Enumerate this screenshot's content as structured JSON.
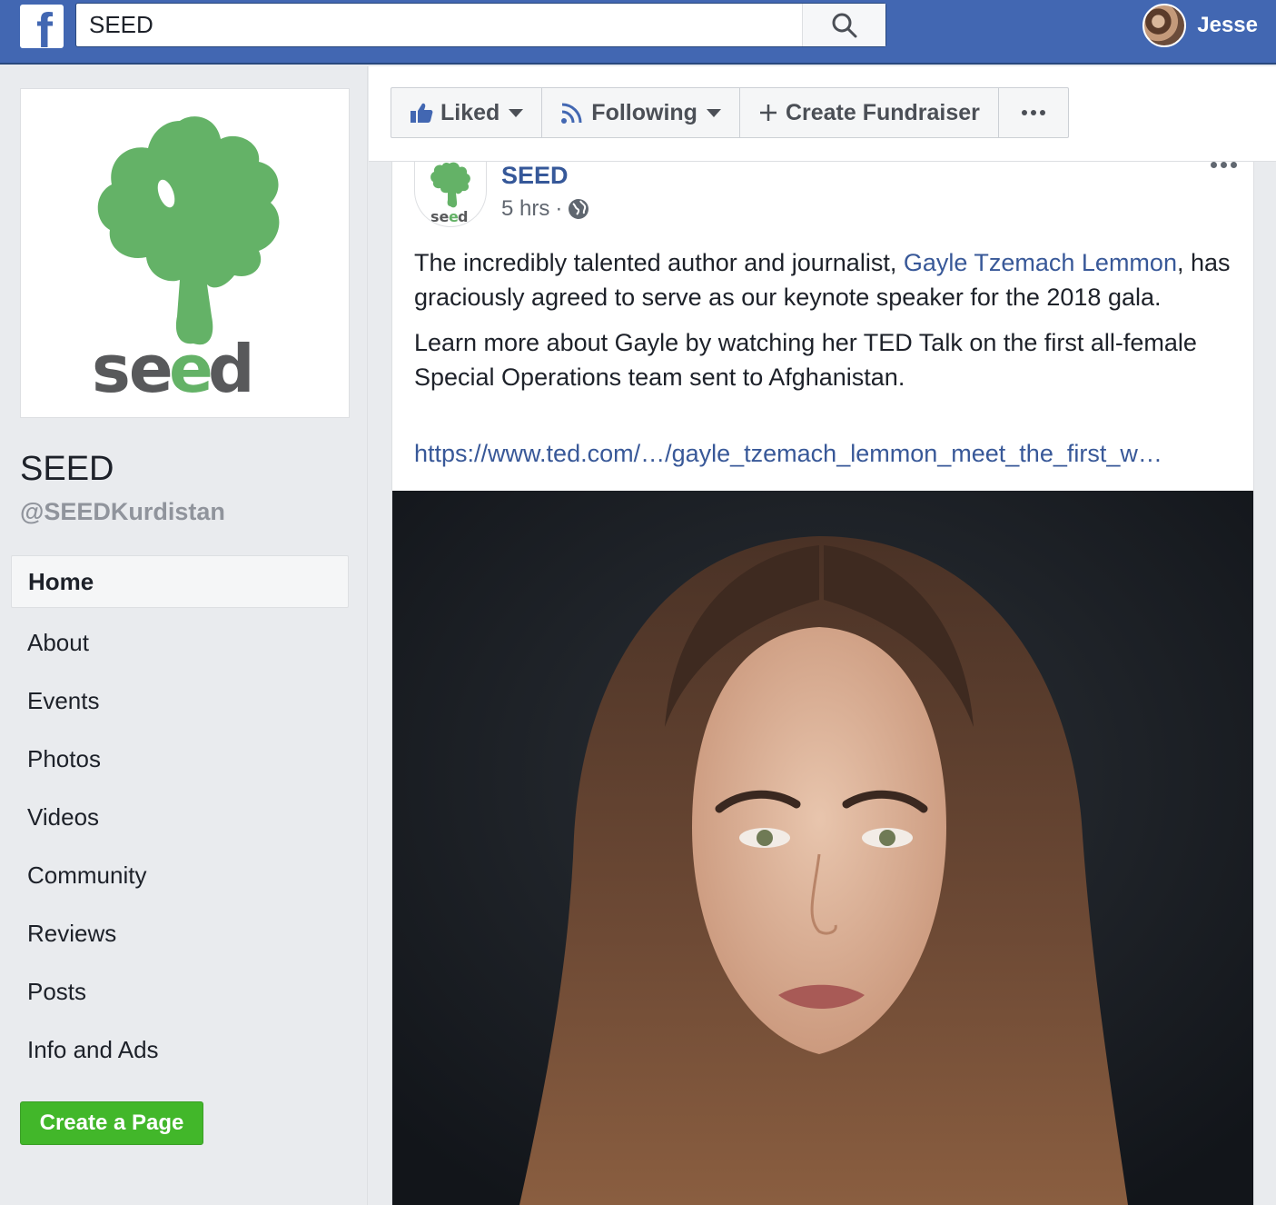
{
  "topbar": {
    "logo_icon": "facebook-f-icon",
    "search_value": "SEED",
    "search_icon": "search-icon",
    "user_name": "Jesse",
    "brand_color": "#4267b2"
  },
  "page": {
    "name": "SEED",
    "handle": "@SEEDKurdistan",
    "logo_text": "seed"
  },
  "nav": {
    "items": [
      {
        "label": "Home",
        "active": true
      },
      {
        "label": "About"
      },
      {
        "label": "Events"
      },
      {
        "label": "Photos"
      },
      {
        "label": "Videos"
      },
      {
        "label": "Community"
      },
      {
        "label": "Reviews"
      },
      {
        "label": "Posts"
      },
      {
        "label": "Info and Ads"
      }
    ],
    "create_page_label": "Create a Page"
  },
  "actions": {
    "liked_label": "Liked",
    "following_label": "Following",
    "fundraiser_label": "Create Fundraiser"
  },
  "post": {
    "author": "SEED",
    "time": "5 hrs",
    "separator": "·",
    "avatar_text": "seed",
    "text1_before": "The incredibly talented author and journalist, ",
    "text1_link": "Gayle Tzemach Lemmon",
    "text1_after": ", has graciously agreed to serve as our keynote speaker for the 2018 gala.",
    "text2": "Learn more about Gayle by watching her TED Talk on the first all-female Special Operations team sent to Afghanistan.",
    "url": "https://www.ted.com/…/gayle_tzemach_lemmon_meet_the_first_w…"
  }
}
